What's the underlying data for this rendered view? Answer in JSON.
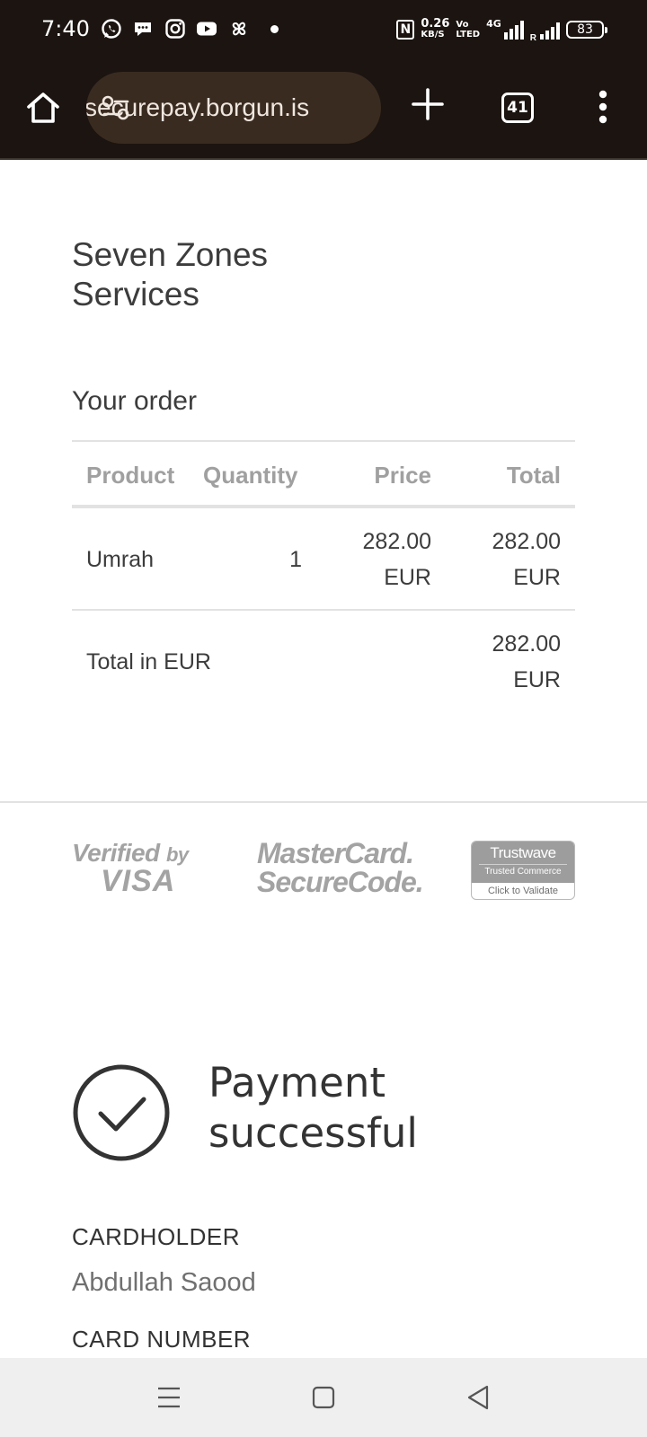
{
  "status_bar": {
    "time": "7:40",
    "app_icons": [
      "whatsapp-icon",
      "chat-bubble-icon",
      "instagram-icon",
      "youtube-icon",
      "pinwheel-icon"
    ],
    "nfc": "N",
    "speed_value": "0.26",
    "speed_unit": "KB/S",
    "volte_top": "Vo",
    "volte_bottom": "LTED",
    "network": "4G",
    "roaming": "R",
    "battery": "83"
  },
  "browser": {
    "url": "securepay.borgun.is",
    "tab_count": "41"
  },
  "page": {
    "merchant_name": "Seven Zones Services",
    "order_title": "Your order",
    "table": {
      "headers": {
        "product": "Product",
        "quantity": "Quantity",
        "price": "Price",
        "total": "Total"
      },
      "rows": [
        {
          "product": "Umrah",
          "quantity": "1",
          "price_amount": "282.00",
          "price_currency": "EUR",
          "total_amount": "282.00",
          "total_currency": "EUR"
        }
      ],
      "grand_total": {
        "label": "Total in EUR",
        "amount": "282.00",
        "currency": "EUR"
      }
    },
    "logos": {
      "visa_line1": "Verified",
      "visa_by": "by",
      "visa_line2": "VISA",
      "mc_line1": "MasterCard.",
      "mc_line2": "SecureCode.",
      "trustwave_name": "Trustwave",
      "trustwave_sub": "Trusted Commerce",
      "trustwave_click": "Click to Validate"
    },
    "status_message": "Payment successful",
    "cardholder_label": "CARDHOLDER",
    "cardholder_name": "Abdullah Saood",
    "card_number_label": "CARD NUMBER"
  },
  "colors": {
    "chrome_dark": "#1b1410",
    "url_pill": "#3a2b20",
    "text_dark": "#3c3c3c",
    "header_grey": "#a0a0a0",
    "navbar_bg": "#efefef"
  }
}
